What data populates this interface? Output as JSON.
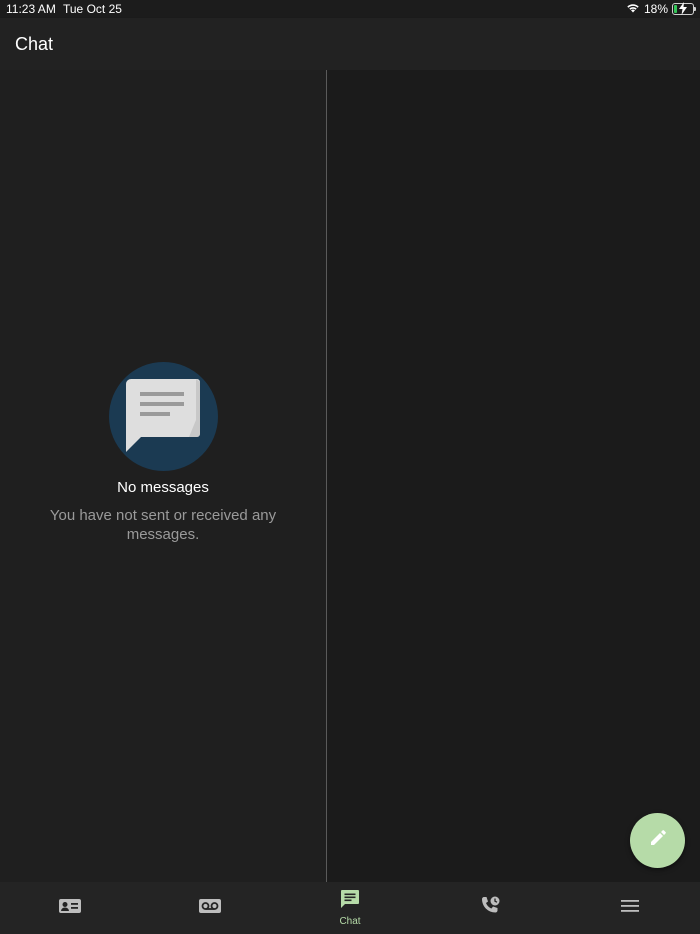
{
  "status_bar": {
    "time": "11:23 AM",
    "date": "Tue Oct 25",
    "battery_percent": "18%",
    "battery_level": 0.18
  },
  "header": {
    "title": "Chat"
  },
  "empty_state": {
    "icon": "chat-bubble-icon",
    "title": "No messages",
    "subtitle": "You have not sent or received any messages."
  },
  "fab": {
    "icon": "pencil-icon"
  },
  "tabs": [
    {
      "icon": "contacts-card-icon",
      "label": "",
      "active": false
    },
    {
      "icon": "voicemail-icon",
      "label": "",
      "active": false
    },
    {
      "icon": "chat-icon",
      "label": "Chat",
      "active": true
    },
    {
      "icon": "phone-recents-icon",
      "label": "",
      "active": false
    },
    {
      "icon": "menu-icon",
      "label": "",
      "active": false
    }
  ],
  "colors": {
    "accent": "#b6dba8",
    "background": "#1c1c1c",
    "header": "#222222",
    "empty_icon_circle": "#1b3a52",
    "inactive_icon": "#bdbdbd"
  }
}
